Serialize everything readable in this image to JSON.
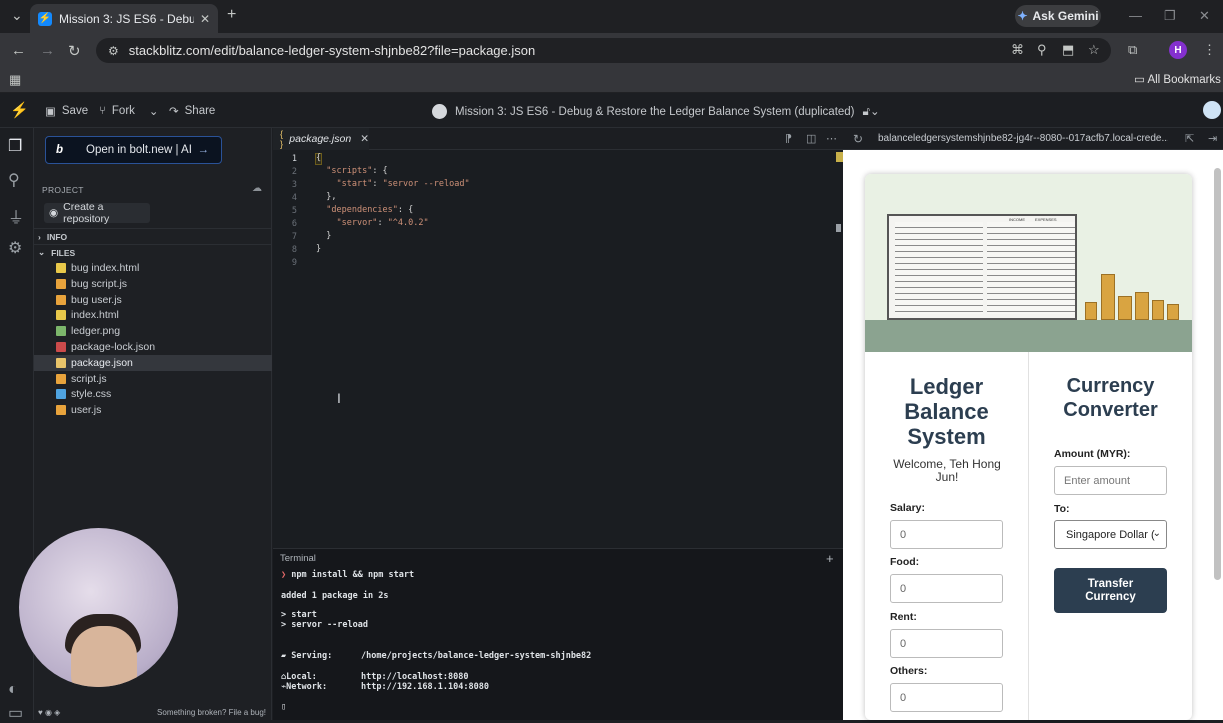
{
  "browser": {
    "tab_title": "Mission 3: JS ES6 - Debug & Re",
    "ask_gemini": "Ask Gemini",
    "url": "stackblitz.com/edit/balance-ledger-system-shjnbe82?file=package.json",
    "profile_initial": "H",
    "all_bookmarks": "All Bookmarks"
  },
  "stackblitz": {
    "save": "Save",
    "fork": "Fork",
    "share": "Share",
    "project_title": "Mission 3: JS ES6 - Debug & Restore the Ledger Balance System (duplicated)",
    "bolt_button": "Open in bolt.new | AI",
    "project_label": "PROJECT",
    "create_repo": "Create a repository",
    "info_section": "INFO",
    "files_section": "FILES",
    "files": [
      {
        "name": "bug index.html",
        "color": "#e8c84a"
      },
      {
        "name": "bug script.js",
        "color": "#e8a33c"
      },
      {
        "name": "bug user.js",
        "color": "#e8a33c"
      },
      {
        "name": "index.html",
        "color": "#e8c84a"
      },
      {
        "name": "ledger.png",
        "color": "#7cb66b"
      },
      {
        "name": "package-lock.json",
        "color": "#cc4b4b"
      },
      {
        "name": "package.json",
        "color": "#e9c46a"
      },
      {
        "name": "script.js",
        "color": "#e8a33c"
      },
      {
        "name": "style.css",
        "color": "#4fa3e0"
      },
      {
        "name": "user.js",
        "color": "#e8a33c"
      }
    ],
    "footer": "Something broken? File a bug!"
  },
  "editor": {
    "tab_name": "package.json",
    "lines": [
      "1",
      "2",
      "3",
      "4",
      "5",
      "6",
      "7",
      "8",
      "9"
    ]
  },
  "terminal": {
    "title": "Terminal",
    "line1": "npm install && npm start",
    "line2": "added 1 package in 2s",
    "line3": "> start",
    "line4": "> servor --reload",
    "serving_label": "Serving:",
    "serving_path": "/home/projects/balance-ledger-system-shjnbe82",
    "local_label": "Local:",
    "local_url": "http://localhost:8080",
    "network_label": "Network:",
    "network_url": "http://192.168.1.104:8080"
  },
  "preview": {
    "url": "balanceledgersystemshjnbe82-jg4r--8080--017acfb7.local-crede...",
    "ledger_title": "Ledger Balance System",
    "welcome": "Welcome, Teh Hong Jun!",
    "salary_label": "Salary:",
    "salary_value": "0",
    "food_label": "Food:",
    "food_value": "0",
    "rent_label": "Rent:",
    "rent_value": "0",
    "others_label": "Others:",
    "others_value": "0",
    "converter_title": "Currency Converter",
    "amount_label": "Amount (MYR):",
    "amount_placeholder": "Enter amount",
    "to_label": "To:",
    "to_selected": "Singapore Dollar (",
    "transfer_button": "Transfer Currency",
    "ledger_income": "INCOME",
    "ledger_expenses": "EXPENSES"
  }
}
